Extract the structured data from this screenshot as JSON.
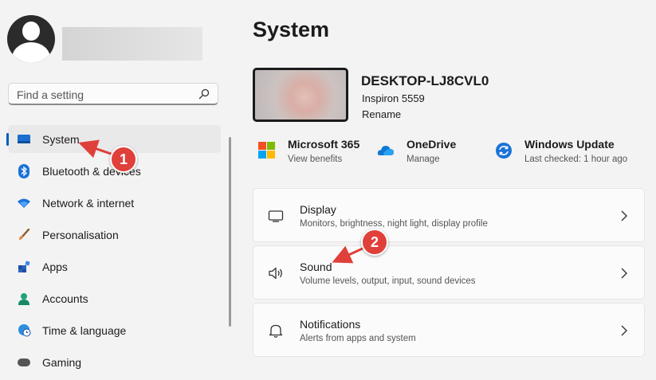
{
  "search": {
    "placeholder": "Find a setting"
  },
  "nav": {
    "items": [
      {
        "label": "System",
        "icon": "monitor-icon",
        "active": true
      },
      {
        "label": "Bluetooth & devices",
        "icon": "bluetooth-icon"
      },
      {
        "label": "Network & internet",
        "icon": "wifi-icon"
      },
      {
        "label": "Personalisation",
        "icon": "brush-icon"
      },
      {
        "label": "Apps",
        "icon": "apps-icon"
      },
      {
        "label": "Accounts",
        "icon": "person-icon"
      },
      {
        "label": "Time & language",
        "icon": "globe-clock-icon"
      },
      {
        "label": "Gaming",
        "icon": "gamepad-icon"
      }
    ]
  },
  "page": {
    "title": "System"
  },
  "device": {
    "name": "DESKTOP-LJ8CVL0",
    "model": "Inspiron 5559",
    "rename": "Rename"
  },
  "quick_links": [
    {
      "title": "Microsoft 365",
      "subtitle": "View benefits",
      "icon": "microsoft-logo-icon"
    },
    {
      "title": "OneDrive",
      "subtitle": "Manage",
      "icon": "onedrive-cloud-icon"
    },
    {
      "title": "Windows Update",
      "subtitle": "Last checked: 1 hour ago",
      "icon": "windows-update-icon"
    }
  ],
  "cards": [
    {
      "title": "Display",
      "subtitle": "Monitors, brightness, night light, display profile",
      "icon": "display-icon"
    },
    {
      "title": "Sound",
      "subtitle": "Volume levels, output, input, sound devices",
      "icon": "speaker-icon"
    },
    {
      "title": "Notifications",
      "subtitle": "Alerts from apps and system",
      "icon": "bell-icon"
    }
  ],
  "annotations": [
    {
      "number": "1"
    },
    {
      "number": "2"
    }
  ],
  "colors": {
    "accent": "#005fb8",
    "annotation": "#e0403a",
    "background": "#f3f3f3"
  }
}
